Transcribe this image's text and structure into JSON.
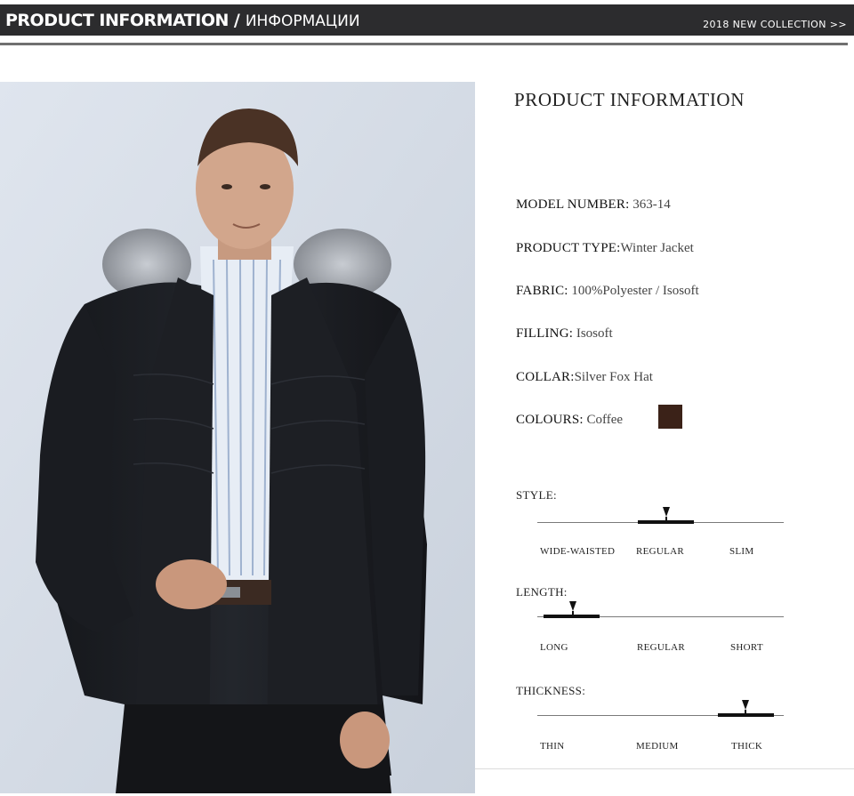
{
  "banner": {
    "title_en": "PRODUCT INFORMATION",
    "separator": "/",
    "title_ru": "ИНФОРМАЦИИ",
    "collection_link": "2018 NEW COLLECTION >>"
  },
  "photo": {
    "alt_icon": "product-photo"
  },
  "info": {
    "heading": "PRODUCT INFORMATION",
    "specs": [
      {
        "key": "MODEL NUMBER:",
        "value": " 363-14"
      },
      {
        "key": "PRODUCT TYPE:",
        "value": "Winter Jacket"
      },
      {
        "key": "FABRIC:",
        "value": " 100%Polyester / Isosoft"
      },
      {
        "key": "FILLING:",
        "value": " Isosoft"
      },
      {
        "key": "COLLAR:",
        "value": "Silver Fox Hat"
      },
      {
        "key": "COLOURS:",
        "value": " Coffee"
      }
    ],
    "colour_swatch": "#3b2218"
  },
  "scales": {
    "style": {
      "title": "STYLE:",
      "options": [
        "WIDE-WAISTED",
        "REGULAR",
        "SLIM"
      ],
      "selected": "REGULAR"
    },
    "length": {
      "title": "LENGTH:",
      "options": [
        "LONG",
        "REGULAR",
        "SHORT"
      ],
      "selected": "LONG"
    },
    "thickness": {
      "title": "THICKNESS:",
      "options": [
        "THIN",
        "MEDIUM",
        "THICK"
      ],
      "selected": "THICK"
    }
  },
  "colors": {
    "banner_bg": "#2c2c2e",
    "photo_bg": "#d3dbe6",
    "jacket": "#1b1d22",
    "fur": "#9ea2a8"
  }
}
